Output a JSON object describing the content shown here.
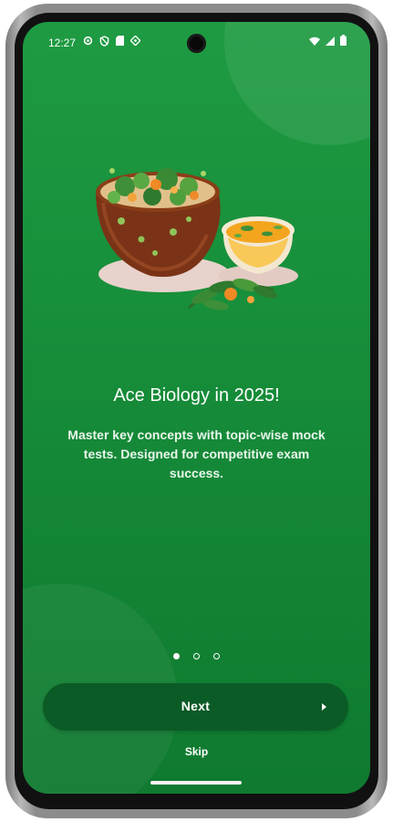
{
  "status_bar": {
    "time": "12:27",
    "left_icons": [
      "settings-icon",
      "shield-icon",
      "sd-card-icon",
      "vpn-icon"
    ],
    "right_icons": [
      "wifi-icon",
      "signal-icon",
      "battery-icon"
    ]
  },
  "onboarding": {
    "title": "Ace Biology in 2025!",
    "description": "Master key concepts with topic-wise mock tests. Designed for competitive exam success.",
    "page_count": 3,
    "active_page": 1,
    "next_label": "Next",
    "skip_label": "Skip"
  },
  "colors": {
    "background_top": "#1e9b42",
    "background_bottom": "#0f7a30",
    "button": "#0b5b26",
    "text": "#ffffff"
  }
}
